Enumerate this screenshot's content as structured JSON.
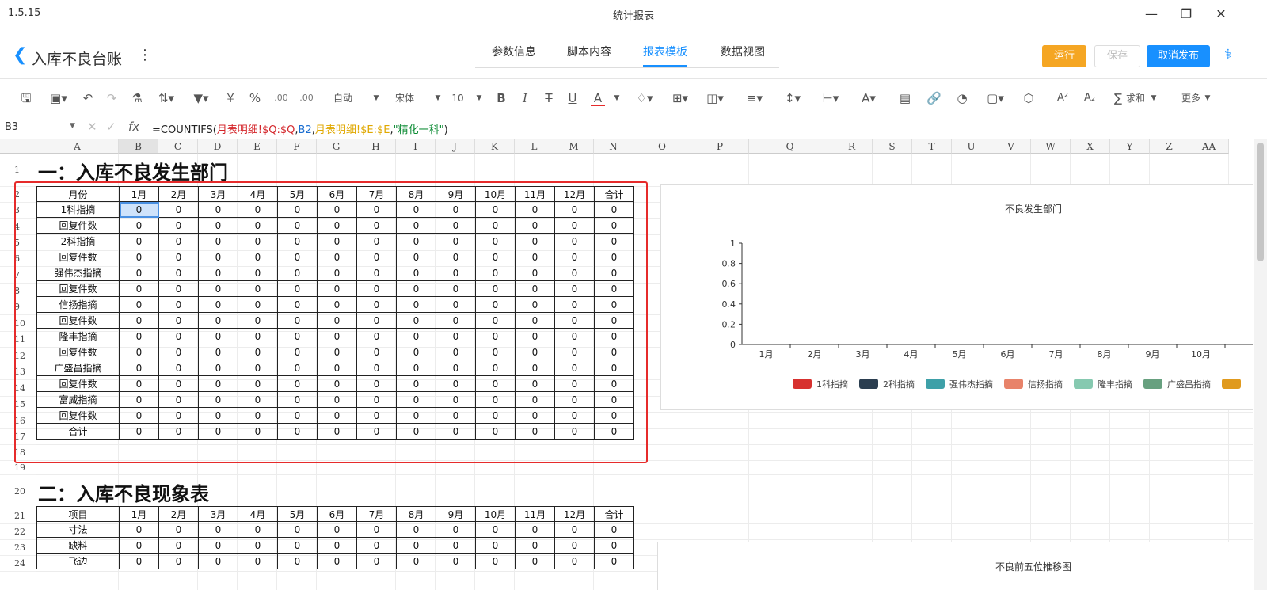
{
  "app": {
    "version": "1.5.15",
    "window_title": "统计报表"
  },
  "header": {
    "title": "入库不良台账",
    "tabs": [
      {
        "label": "参数信息"
      },
      {
        "label": "脚本内容"
      },
      {
        "label": "报表模板",
        "active": true
      },
      {
        "label": "数据视图"
      }
    ],
    "buttons": {
      "run": "运行",
      "save": "保存",
      "unpublish": "取消发布"
    },
    "colors": {
      "accent": "#1890ff",
      "run": "#f5a623"
    }
  },
  "toolbar": {
    "number_format": "自动",
    "font_name": "宋体",
    "font_size": "10",
    "sum_label": "求和",
    "more_label": "更多",
    "currency": "¥",
    "percent": "%",
    "dec_inc": ".00",
    "dec_dec": ".00"
  },
  "formula_bar": {
    "cell": "B3",
    "fx": "fx",
    "parts": [
      {
        "text": "=COUNTIFS(",
        "color": "plain"
      },
      {
        "text": "月表明细!$Q:$Q",
        "color": "r"
      },
      {
        "text": ",",
        "color": "plain"
      },
      {
        "text": "B2",
        "color": "b"
      },
      {
        "text": ",",
        "color": "plain"
      },
      {
        "text": "月表明细!$E:$E",
        "color": "y"
      },
      {
        "text": ",",
        "color": "plain"
      },
      {
        "text": "\"精化一科\"",
        "color": "g"
      },
      {
        "text": ")",
        "color": "plain"
      }
    ]
  },
  "sheet": {
    "columns": [
      "A",
      "B",
      "C",
      "D",
      "E",
      "F",
      "G",
      "H",
      "I",
      "J",
      "K",
      "L",
      "M",
      "N",
      "O",
      "P",
      "Q",
      "R",
      "S",
      "T",
      "U",
      "V",
      "W",
      "X",
      "Y",
      "Z",
      "AA"
    ],
    "rows": [
      "1",
      "2",
      "3",
      "4",
      "5",
      "6",
      "7",
      "8",
      "9",
      "10",
      "11",
      "12",
      "13",
      "14",
      "15",
      "16",
      "17",
      "18",
      "19",
      "20",
      "21",
      "22",
      "23",
      "24"
    ],
    "section1": {
      "title": "一：入库不良发生部门",
      "header": [
        "月份",
        "1月",
        "2月",
        "3月",
        "4月",
        "5月",
        "6月",
        "7月",
        "8月",
        "9月",
        "10月",
        "11月",
        "12月",
        "合计"
      ],
      "row_labels": [
        "1科指摘",
        "回复件数",
        "2科指摘",
        "回复件数",
        "强伟杰指摘",
        "回复件数",
        "信扬指摘",
        "回复件数",
        "隆丰指摘",
        "回复件数",
        "广盛昌指摘",
        "回复件数",
        "富威指摘",
        "回复件数",
        "合计"
      ],
      "value": "0"
    },
    "section2": {
      "title": "二：入库不良现象表",
      "header": [
        "项目",
        "1月",
        "2月",
        "3月",
        "4月",
        "5月",
        "6月",
        "7月",
        "8月",
        "9月",
        "10月",
        "11月",
        "12月",
        "合计"
      ],
      "row_labels": [
        "寸法",
        "缺料",
        "飞边"
      ],
      "value": "0"
    }
  },
  "chart_data": [
    {
      "type": "bar",
      "title": "不良发生部门",
      "categories": [
        "1月",
        "2月",
        "3月",
        "4月",
        "5月",
        "6月",
        "7月",
        "8月",
        "9月",
        "10月"
      ],
      "ylim": [
        0,
        1
      ],
      "yticks": [
        "1",
        "0.8",
        "0.6",
        "0.4",
        "0.2",
        "0"
      ],
      "series": [
        {
          "name": "1科指摘",
          "color": "#d7312f",
          "values": [
            0,
            0,
            0,
            0,
            0,
            0,
            0,
            0,
            0,
            0
          ]
        },
        {
          "name": "2科指摘",
          "color": "#2b3e50",
          "values": [
            0,
            0,
            0,
            0,
            0,
            0,
            0,
            0,
            0,
            0
          ]
        },
        {
          "name": "强伟杰指摘",
          "color": "#3ea0a8",
          "values": [
            0,
            0,
            0,
            0,
            0,
            0,
            0,
            0,
            0,
            0
          ]
        },
        {
          "name": "信扬指摘",
          "color": "#e8836a",
          "values": [
            0,
            0,
            0,
            0,
            0,
            0,
            0,
            0,
            0,
            0
          ]
        },
        {
          "name": "隆丰指摘",
          "color": "#86c9b0",
          "values": [
            0,
            0,
            0,
            0,
            0,
            0,
            0,
            0,
            0,
            0
          ]
        },
        {
          "name": "广盛昌指摘",
          "color": "#67a07f",
          "values": [
            0,
            0,
            0,
            0,
            0,
            0,
            0,
            0,
            0,
            0
          ]
        },
        {
          "name": "",
          "color": "#e09a1e",
          "values": [
            0,
            0,
            0,
            0,
            0,
            0,
            0,
            0,
            0,
            0
          ]
        }
      ],
      "legend": "bottom"
    },
    {
      "type": "line",
      "title": "不良前五位推移图"
    }
  ]
}
